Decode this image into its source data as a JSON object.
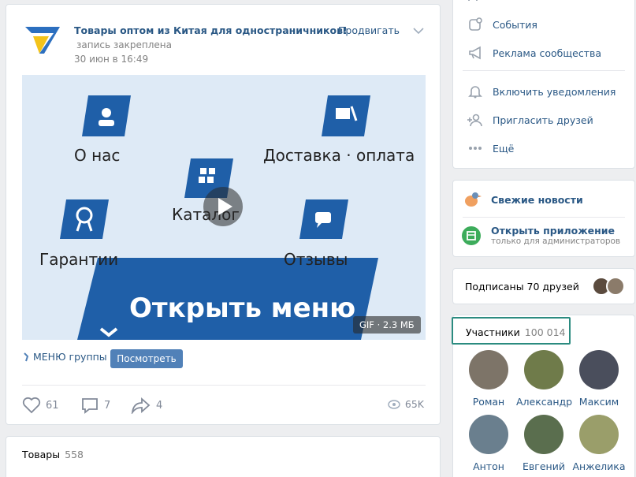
{
  "post": {
    "author": "Товары оптом из Китая для одностраничников!",
    "pinned": "запись закреплена",
    "date": "30 июн в 16:49",
    "promote_label": "Продвигать",
    "gif": {
      "labels": {
        "about": "О нас",
        "delivery": "Доставка · оплата",
        "catalog": "Каталог",
        "guarantees": "Гарантии",
        "reviews": "Отзывы",
        "open_menu": "Открыть меню"
      },
      "badge": "GIF · 2.3 МБ"
    },
    "menu_link": "МЕНЮ группы",
    "view_button": "Посмотреть",
    "likes": "61",
    "comments": "7",
    "shares": "4",
    "views": "65K"
  },
  "goods": {
    "title": "Товары",
    "count": "558"
  },
  "sidebar": {
    "items": [
      {
        "label": "События",
        "icon": "events-icon"
      },
      {
        "label": "Реклама сообщества",
        "icon": "megaphone-icon"
      },
      {
        "label": "Включить уведомления",
        "icon": "bell-icon"
      },
      {
        "label": "Пригласить друзей",
        "icon": "invite-icon"
      },
      {
        "label": "Ещё",
        "icon": "more-icon"
      }
    ],
    "news": "Свежие новости",
    "app_title": "Открыть приложение",
    "app_sub": "только для администраторов",
    "friends_subscribed": "Подписаны 70 друзей",
    "members_title": "Участники",
    "members_count": "100 014",
    "members": [
      "Роман",
      "Александр",
      "Максим",
      "Антон",
      "Евгений",
      "Анжелика"
    ]
  },
  "colors": {
    "link": "#2a5885",
    "accent": "#5181b8",
    "tile": "#1f5fa8",
    "highlight": "#2b8b80"
  }
}
